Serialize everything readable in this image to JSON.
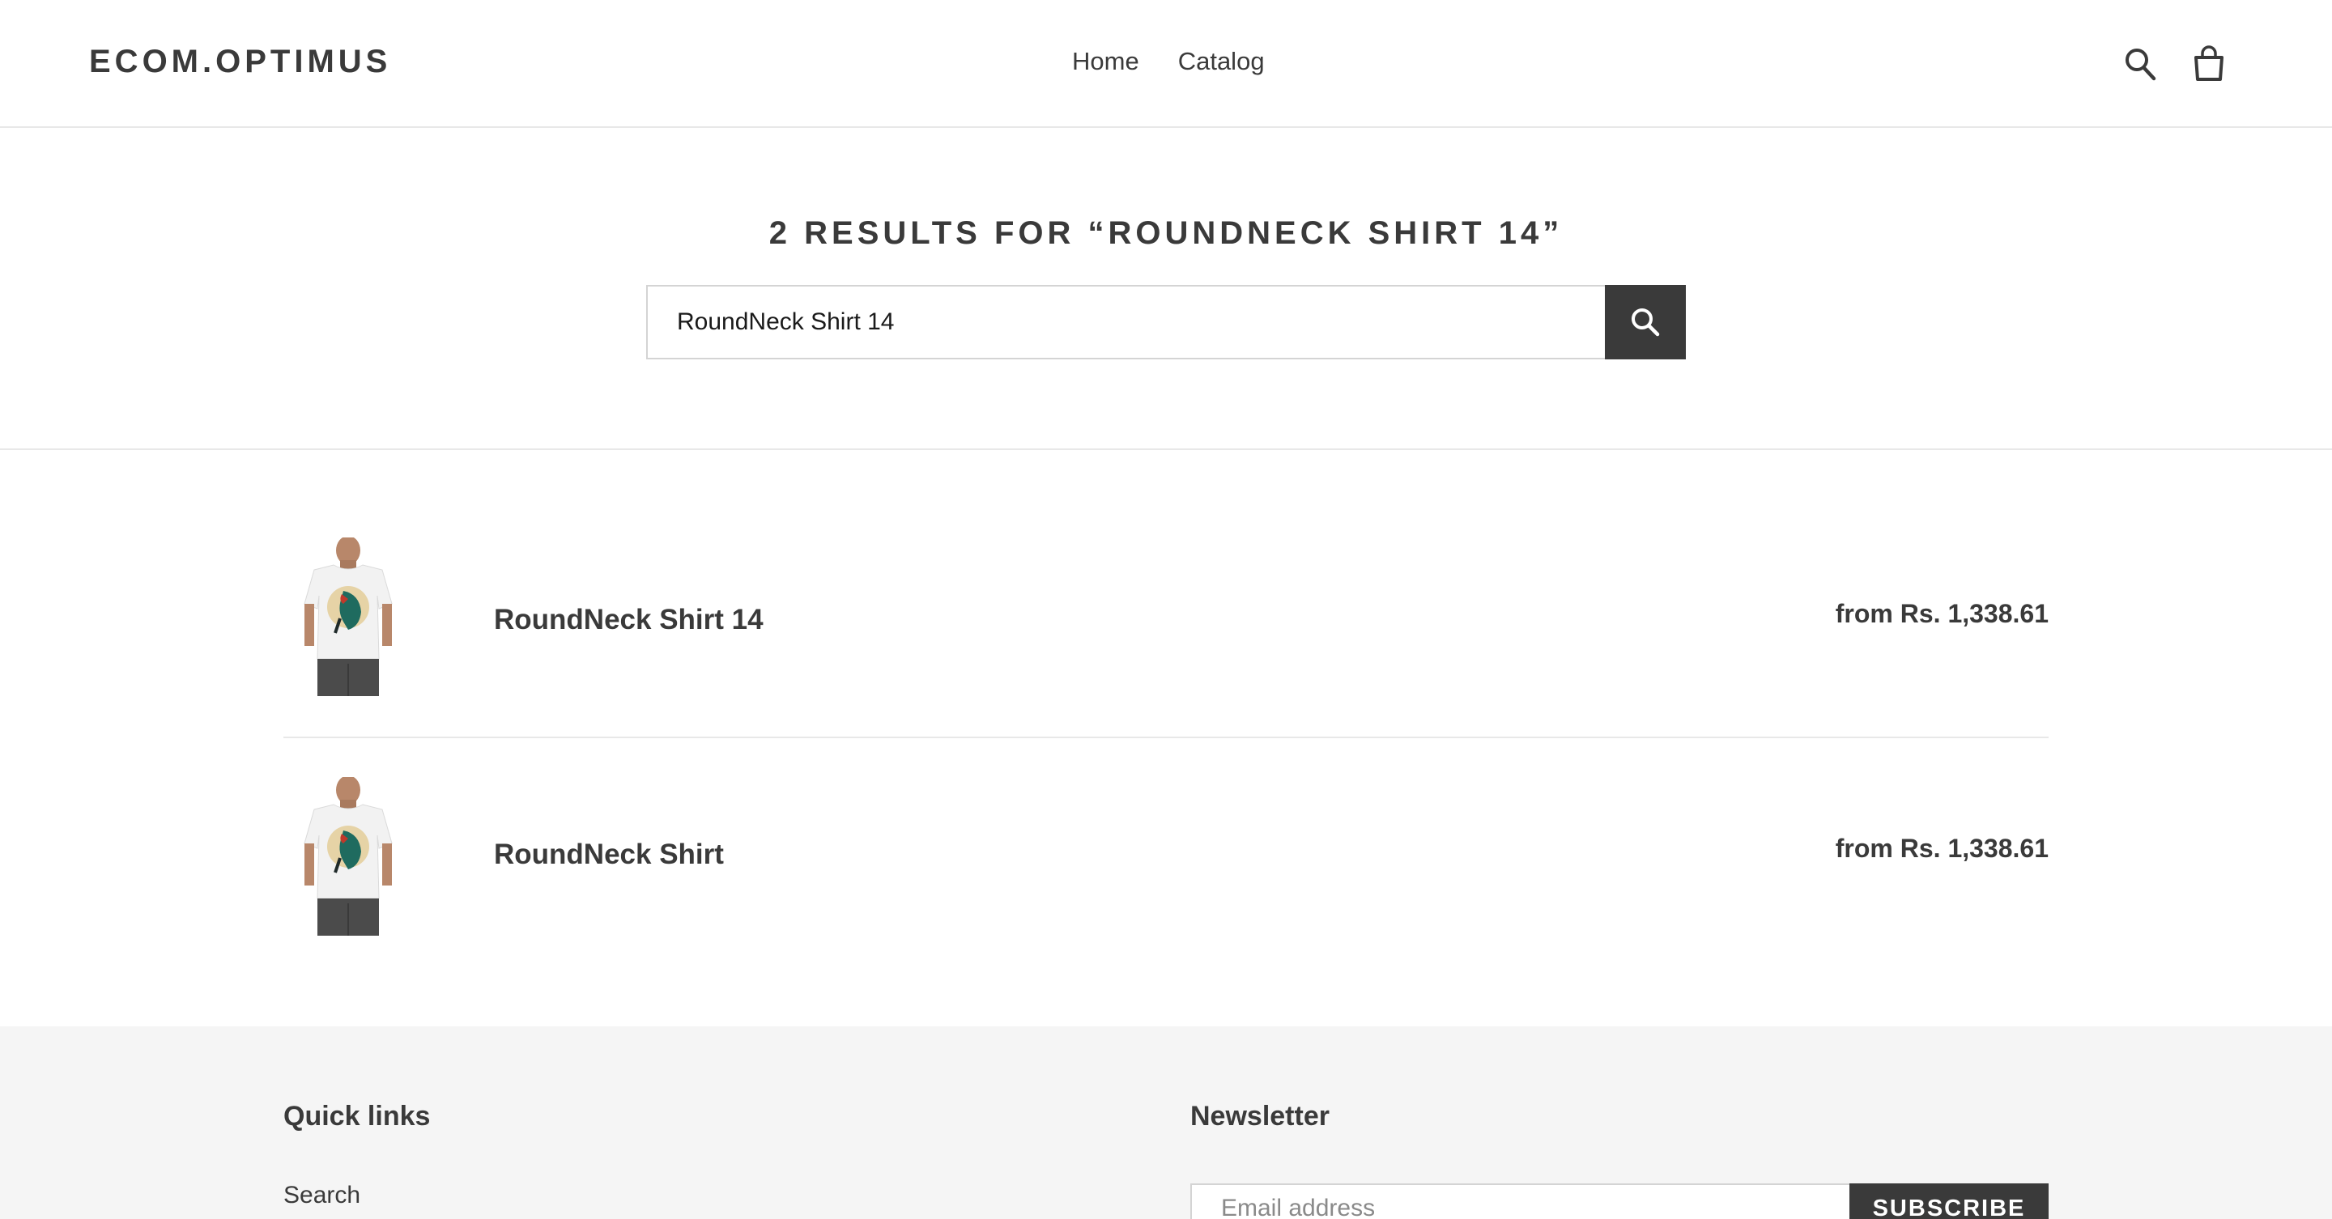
{
  "header": {
    "logo": "ECOM.OPTIMUS",
    "nav": [
      "Home",
      "Catalog"
    ],
    "icons": [
      "search-icon",
      "cart-icon"
    ]
  },
  "search": {
    "results_title": "2 RESULTS FOR “ROUNDNECK SHIRT 14”",
    "query": "RoundNeck Shirt 14",
    "button_icon": "search-icon"
  },
  "results": [
    {
      "title": "RoundNeck Shirt 14",
      "price": "from Rs. 1,338.61",
      "image_icon": "tshirt-parrot-image"
    },
    {
      "title": "RoundNeck Shirt",
      "price": "from Rs. 1,338.61",
      "image_icon": "tshirt-parrot-image"
    }
  ],
  "footer": {
    "quick_links_heading": "Quick links",
    "quick_links": [
      "Search"
    ],
    "newsletter_heading": "Newsletter",
    "email_placeholder": "Email address",
    "subscribe_label": "SUBSCRIBE"
  },
  "colors": {
    "text": "#3a3a3a",
    "button_bg": "#3a3a3a",
    "border": "#e8e8e8",
    "footer_bg": "#f5f5f5"
  }
}
